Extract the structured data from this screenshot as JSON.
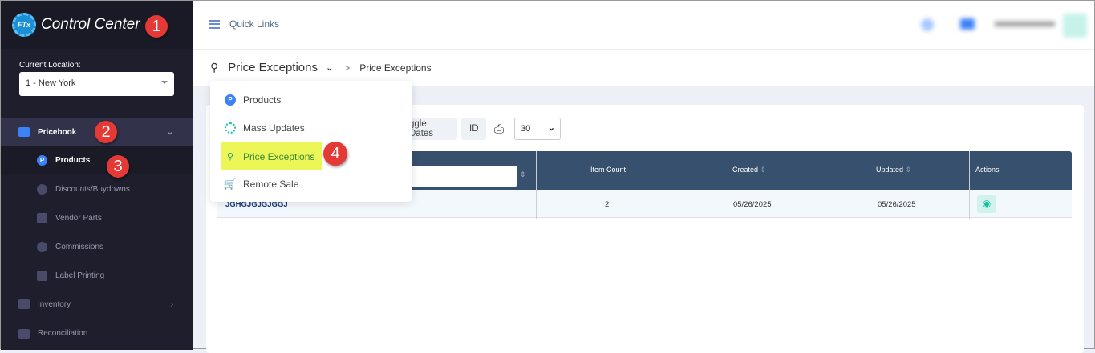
{
  "app": {
    "title": "Control Center",
    "logo_mark": "FTx"
  },
  "sidebar": {
    "location_label": "Current Location:",
    "location_value": "1 - New York",
    "items": [
      {
        "label": "Pricebook",
        "icon": "calculator-icon"
      },
      {
        "label": "Products",
        "icon": "p-circle-icon"
      },
      {
        "label": "Discounts/Buydowns",
        "icon": "discount-gear-icon"
      },
      {
        "label": "Vendor Parts",
        "icon": "dolly-icon"
      },
      {
        "label": "Commissions",
        "icon": "money-bag-icon"
      },
      {
        "label": "Label Printing",
        "icon": "tag-icon"
      },
      {
        "label": "Inventory",
        "icon": "warehouse-icon"
      },
      {
        "label": "Reconciliation",
        "icon": "grid-icon"
      }
    ]
  },
  "topbar": {
    "quick_links": "Quick Links"
  },
  "breadcrumb": {
    "title": "Price Exceptions",
    "current": "Price Exceptions"
  },
  "menu": {
    "items": [
      "Products",
      "Mass Updates",
      "Price Exceptions",
      "Remote Sale"
    ]
  },
  "toolbar": {
    "toggle_dates": "ggle Dates",
    "id": "ID",
    "per_page": "30"
  },
  "table": {
    "headers": [
      "Item Count",
      "Created",
      "Updated",
      "Actions"
    ],
    "rows": [
      {
        "name": "JGHGJGJGJGGJ",
        "item_count": "2",
        "created": "05/26/2025",
        "updated": "05/26/2025"
      }
    ]
  },
  "annotations": [
    "1",
    "2",
    "3",
    "4"
  ],
  "colors": {
    "sidebar": "#1e1e2d",
    "header": "#37506d",
    "highlight": "#ecf757",
    "badge": "#e53935"
  }
}
